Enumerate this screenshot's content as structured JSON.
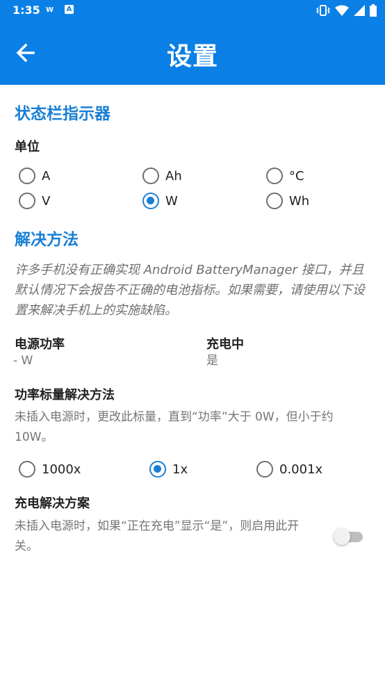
{
  "status_bar": {
    "time": "1:35",
    "notif_w": "W",
    "notif_a": "A",
    "icons": [
      "vibrate-icon",
      "wifi-icon",
      "signal-icon",
      "battery-icon"
    ]
  },
  "app_bar": {
    "title": "设置",
    "back_icon": "arrow-left-icon",
    "color": "#0a7fe6"
  },
  "section_indicator": {
    "title": "状态栏指示器",
    "unit_label": "单位",
    "options": [
      "A",
      "Ah",
      "°C",
      "V",
      "W",
      "Wh"
    ],
    "selected": "W"
  },
  "section_workaround": {
    "title": "解决方法",
    "description": "许多手机没有正确实现 Android BatteryManager 接口，并且默认情况下会报告不正确的电池指标。如果需要，请使用以下设置来解决手机上的实施缺陷。",
    "power": {
      "label": "电源功率",
      "value": "- W"
    },
    "charging": {
      "label": "充电中",
      "value": "是"
    },
    "scale": {
      "title": "功率标量解决方法",
      "description": "未插入电源时，更改此标量，直到“功率”大于 0W，但小于约 10W。",
      "options": [
        "1000x",
        "1x",
        "0.001x"
      ],
      "selected": "1x"
    },
    "charge_fix": {
      "title": "充电解决方案",
      "description": "未插入电源时，如果“正在充电”显示“是”，则启用此开关。",
      "enabled": false
    }
  },
  "accent_color": "#1a7fd4"
}
